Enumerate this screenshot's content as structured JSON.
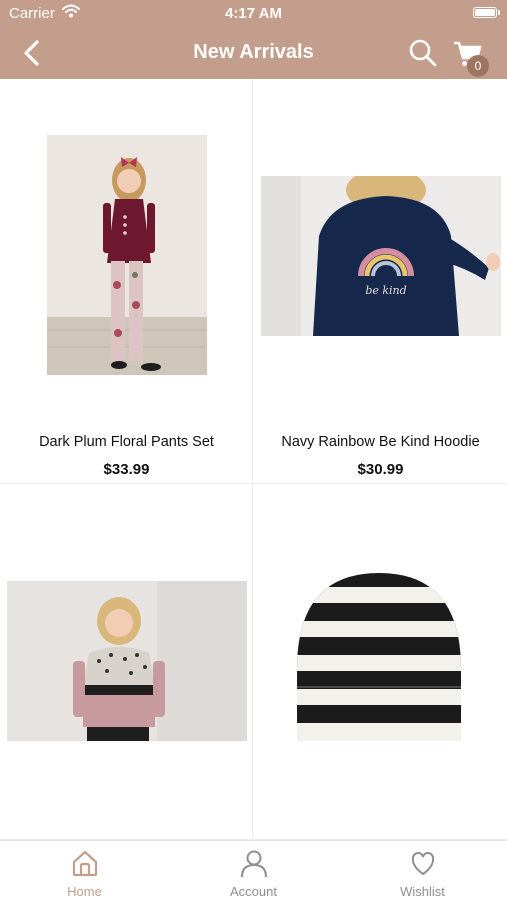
{
  "status_bar": {
    "carrier": "Carrier",
    "time": "4:17 AM"
  },
  "header": {
    "title": "New Arrivals",
    "cart_count": "0"
  },
  "products": [
    {
      "name": "Dark Plum Floral Pants Set",
      "price": "$33.99",
      "image": "girl in dark plum top with floral pants"
    },
    {
      "name": "Navy Rainbow Be Kind Hoodie",
      "price": "$30.99",
      "image": "child in navy rainbow hoodie"
    },
    {
      "name": "",
      "price": "",
      "image": "girl in leopard color-block sweatshirt"
    },
    {
      "name": "",
      "price": "",
      "image": "black and white striped beanie"
    }
  ],
  "tab_bar": [
    {
      "label": "Home",
      "icon": "home-icon",
      "active": true
    },
    {
      "label": "Account",
      "icon": "person-icon",
      "active": false
    },
    {
      "label": "Wishlist",
      "icon": "heart-icon",
      "active": false
    }
  ],
  "colors": {
    "header_bg": "#c49e8d",
    "badge_bg": "#9d7563",
    "active_tab": "#c49e8d",
    "inactive_tab": "#8e8e93"
  }
}
